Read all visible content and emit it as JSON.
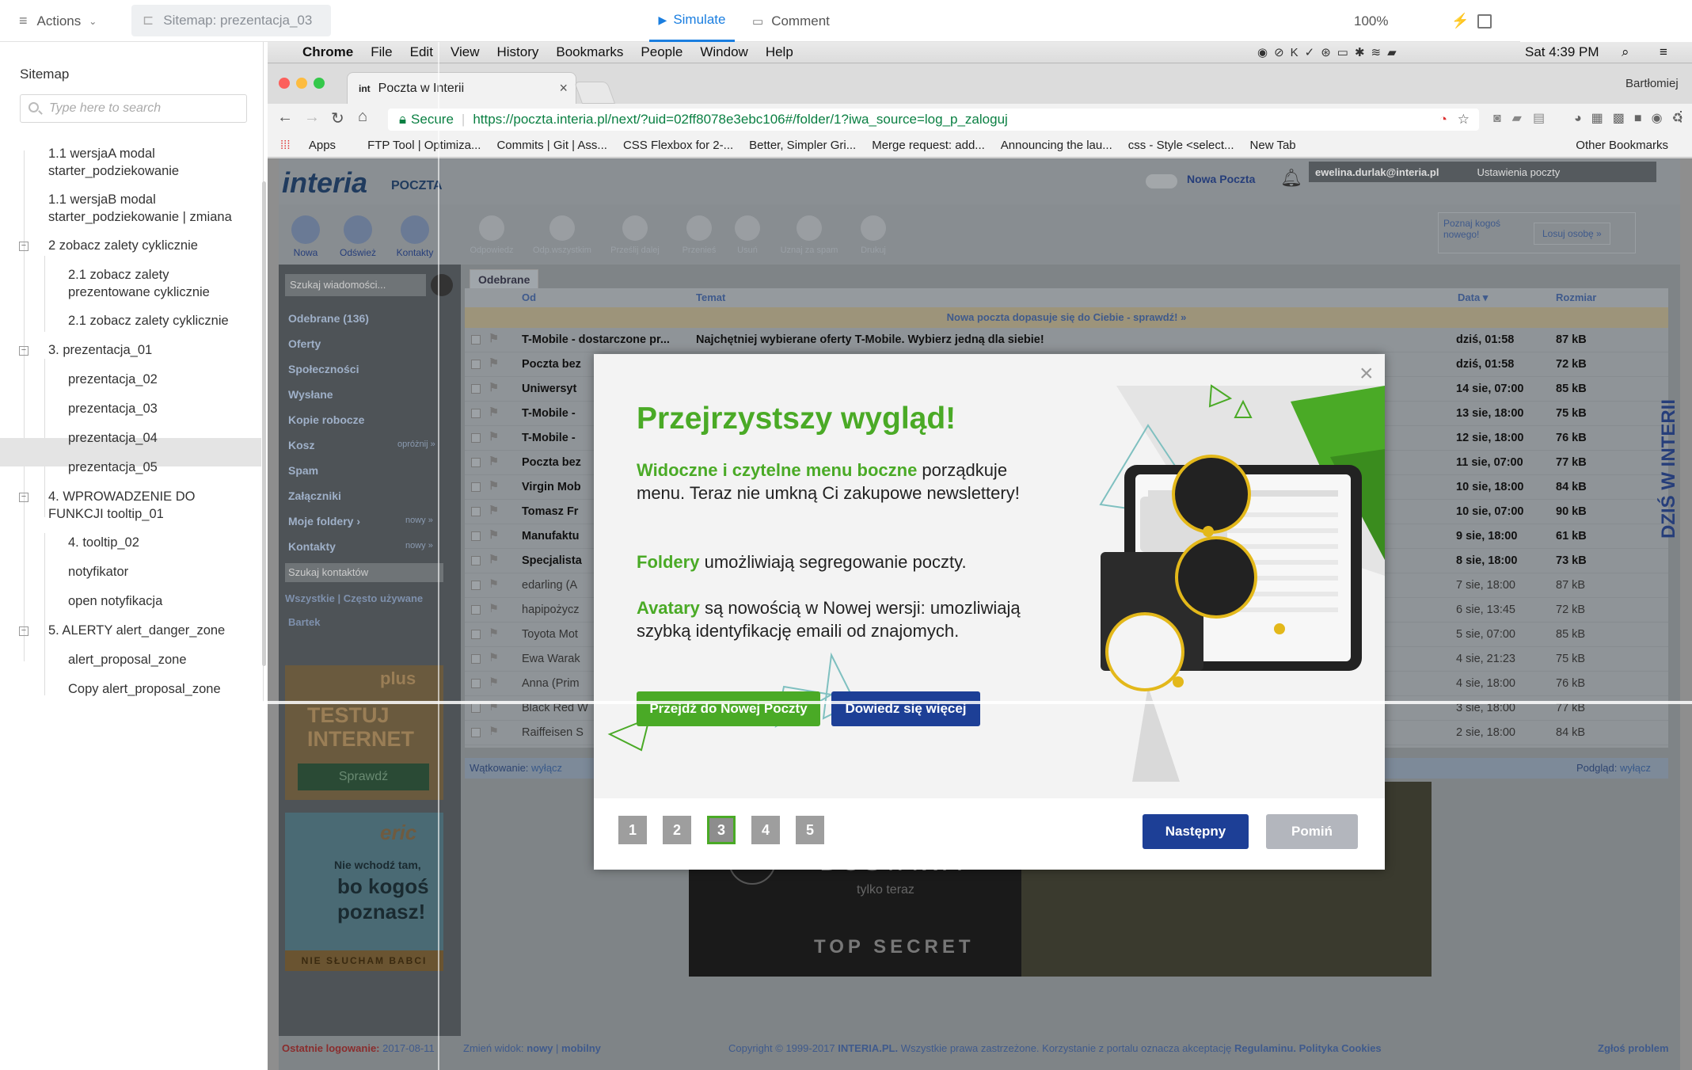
{
  "topbar": {
    "actions": "Actions",
    "sitemap_chip": "Sitemap: prezentacja_03",
    "simulate": "Simulate",
    "comment": "Comment",
    "zoom": "100%"
  },
  "sidebar": {
    "title": "Sitemap",
    "search_placeholder": "Type here to search",
    "items": [
      {
        "label": "1.1 wersjaA modal starter_podziekowanie"
      },
      {
        "label": "1.1 wersjaB modal starter_podziekowanie | zmiana"
      },
      {
        "label": "2 zobacz zalety cyklicznie"
      },
      {
        "label": "2.1 zobacz zalety prezentowane cyklicznie"
      },
      {
        "label": "2.1 zobacz zalety cyklicznie"
      },
      {
        "label": "3. prezentacja_01"
      },
      {
        "label": "prezentacja_02"
      },
      {
        "label": "prezentacja_03"
      },
      {
        "label": "prezentacja_04"
      },
      {
        "label": "prezentacja_05"
      },
      {
        "label": "4. WPROWADZENIE DO FUNKCJI tooltip_01"
      },
      {
        "label": "4. tooltip_02"
      },
      {
        "label": "notyfikator"
      },
      {
        "label": "open notyfikacja"
      },
      {
        "label": "5. ALERTY alert_danger_zone"
      },
      {
        "label": "alert_proposal_zone"
      },
      {
        "label": "Copy alert_proposal_zone"
      }
    ]
  },
  "mac": {
    "menu": [
      "Chrome",
      "File",
      "Edit",
      "View",
      "History",
      "Bookmarks",
      "People",
      "Window",
      "Help"
    ],
    "clock": "Sat 4:39 PM",
    "user": "Bartłomiej"
  },
  "browser": {
    "tab_title": "Poczta w Interii",
    "tab_favicon": "int",
    "secure": "Secure",
    "url": "https://poczta.interia.pl/next/?uid=02ff8078e3ebc106#/folder/1?iwa_source=log_p_zaloguj",
    "bookmarks": [
      "Apps",
      "FTP Tool | Optimiza...",
      "Commits | Git | Ass...",
      "CSS Flexbox for 2-...",
      "Better, Simpler Gri...",
      "Merge request: add...",
      "Announcing the lau...",
      "css - Style <select...",
      "New Tab",
      "Other Bookmarks"
    ]
  },
  "mail": {
    "logo": "interia",
    "logo_sub": "POCZTA",
    "new_mail": "Nowa Poczta",
    "account": "ewelina.durlak@interia.pl",
    "settings": "Ustawienia poczty",
    "toolbar": [
      "Nowa",
      "Odśwież",
      "Kontakty",
      "Odpowiedz",
      "Odp.wszystkim",
      "Prześlij dalej",
      "Przenieś",
      "Usuń",
      "Uznaj za spam",
      "Drukuj"
    ],
    "promo_text": "Poznaj kogoś nowego!",
    "promo_btn": "Losuj osobę »",
    "search_placeholder": "Szukaj wiadomości...",
    "folder_tab": "Odebrane",
    "folders": [
      "Odebrane (136)",
      "Oferty",
      "Społeczności",
      "Wysłane",
      "Kopie robocze",
      "Kosz",
      "Spam",
      "Załączniki",
      "Moje foldery ›",
      "Kontakty"
    ],
    "folder_actions": {
      "kosz": "opróżnij »",
      "moje": "nowy »",
      "kontakty": "nowy »"
    },
    "contacts_search": "Szukaj kontaktów",
    "contacts_tabs": [
      "Wszystkie",
      "Często używane"
    ],
    "contact": "Bartek",
    "columns": {
      "from": "Od",
      "subject": "Temat",
      "date": "Data ▾",
      "size": "Rozmiar"
    },
    "banner": "Nowa poczta dopasuje się do Ciebie - sprawdź! »",
    "rows": [
      {
        "from": "T-Mobile - dostarczone pr...",
        "subject": "Najchętniej wybierane oferty T-Mobile. Wybierz jedną dla siebie!",
        "date": "dziś, 01:58",
        "size": "87 kB",
        "bold": true
      },
      {
        "from": "Poczta bez",
        "subject": "",
        "date": "dziś, 01:58",
        "size": "72 kB",
        "bold": true
      },
      {
        "from": "Uniwersyt",
        "subject": "",
        "date": "14 sie, 07:00",
        "size": "85 kB",
        "bold": true
      },
      {
        "from": "T-Mobile -",
        "subject": "",
        "date": "13 sie, 18:00",
        "size": "75 kB",
        "bold": true
      },
      {
        "from": "T-Mobile -",
        "subject": "",
        "date": "12 sie, 18:00",
        "size": "76 kB",
        "bold": true
      },
      {
        "from": "Poczta bez",
        "subject": "",
        "date": "11 sie, 07:00",
        "size": "77 kB",
        "bold": true
      },
      {
        "from": "Virgin Mob",
        "subject": "",
        "date": "10 sie, 18:00",
        "size": "84 kB",
        "bold": true
      },
      {
        "from": "Tomasz Fr",
        "subject": "",
        "date": "10 sie, 07:00",
        "size": "90 kB",
        "bold": true
      },
      {
        "from": "Manufaktu",
        "subject": "",
        "date": "9 sie, 18:00",
        "size": "61 kB",
        "bold": true
      },
      {
        "from": "Specjalista",
        "subject": "",
        "date": "8 sie, 18:00",
        "size": "73 kB",
        "bold": true
      },
      {
        "from": "edarling (A",
        "subject": "",
        "date": "7 sie, 18:00",
        "size": "87 kB",
        "bold": false
      },
      {
        "from": "hapipożycz",
        "subject": "",
        "date": "6 sie, 13:45",
        "size": "72 kB",
        "bold": false
      },
      {
        "from": "Toyota Mot",
        "subject": "",
        "date": "5 sie, 07:00",
        "size": "85 kB",
        "bold": false
      },
      {
        "from": "Ewa Warak",
        "subject": "",
        "date": "4 sie, 21:23",
        "size": "75 kB",
        "bold": false
      },
      {
        "from": "Anna (Prim",
        "subject": "",
        "date": "4 sie, 18:00",
        "size": "76 kB",
        "bold": false
      },
      {
        "from": "Black Red W",
        "subject": "",
        "date": "3 sie, 18:00",
        "size": "77 kB",
        "bold": false
      },
      {
        "from": "Raiffeisen S",
        "subject": "",
        "date": "2 sie, 18:00",
        "size": "84 kB",
        "bold": false
      }
    ],
    "threading": "Wątkowanie:",
    "threading_val": "wyłącz",
    "preview": "Podgląd:",
    "preview_val": "wyłącz",
    "ad1": {
      "brand": "plus",
      "line1": "TESTUJ",
      "line2": "INTERNET",
      "btn": "Sprawdź"
    },
    "ad2": {
      "brand": "eric",
      "line1": "Nie wchodź tam,",
      "line2": "bo kogoś",
      "line3": "poznasz!",
      "footer": "NIE SŁUCHAM BABCI"
    },
    "ad3": {
      "price": "0zł",
      "title": "DOSTAWA",
      "sub": "tylko teraz",
      "footer": "TOP SECRET"
    },
    "vertical": "DZIŚ W INTERII",
    "footer": {
      "last_login_label": "Ostatnie logowanie:",
      "last_login": "2017-08-11",
      "change_view": "Zmień widok:",
      "view_new": "nowy",
      "view_mobile": "mobilny",
      "copyright": "Copyright © 1999-2017",
      "brand": "INTERIA.PL.",
      "copy_rest": "Wszystkie prawa zastrzeżone. Korzystanie z portalu oznacza akceptację",
      "terms": "Regulaminu.",
      "cookies": "Polityka Cookies",
      "report": "Zgłoś problem"
    }
  },
  "modal": {
    "title": "Przejrzystszy wygląd!",
    "p1_bold": "Widoczne i czytelne menu boczne",
    "p1_rest": " porządkuje menu. Teraz nie umkną Ci zakupowe newslettery!",
    "p2_bold": "Foldery",
    "p2_rest": " umożliwiają segregowanie poczty.",
    "p3_bold": "Avatary",
    "p3_rest": " są nowością w Nowej wersji: umozliwiają szybką identyfikację emaili od znajomych.",
    "btn_go": "Przejdź do Nowej Poczty",
    "btn_more": "Dowiedz się więcej",
    "pages": [
      "1",
      "2",
      "3",
      "4",
      "5"
    ],
    "active_page": 3,
    "btn_next": "Następny",
    "btn_skip": "Pomiń"
  },
  "colors": {
    "green": "#4aaa26",
    "navy": "#1d3f96",
    "accent_blue": "#1a7ee0"
  }
}
